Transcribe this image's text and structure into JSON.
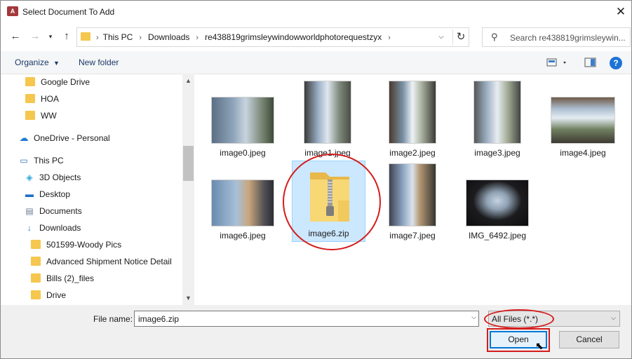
{
  "window": {
    "title": "Select Document To Add",
    "app_icon_text": "A"
  },
  "nav": {
    "breadcrumbs": [
      "This PC",
      "Downloads",
      "re438819grimsleywindowworldphotorequestzyx"
    ],
    "search_placeholder": "Search re438819grimsleywin..."
  },
  "toolbar": {
    "organize_label": "Organize",
    "new_folder_label": "New folder"
  },
  "sidebar": {
    "items": [
      {
        "label": "Google Drive",
        "icon": "folder-icon"
      },
      {
        "label": "HOA",
        "icon": "folder-icon"
      },
      {
        "label": "WW",
        "icon": "folder-icon"
      },
      {
        "label": "OneDrive - Personal",
        "icon": "cloud-icon"
      },
      {
        "label": "This PC",
        "icon": "computer-icon"
      },
      {
        "label": "3D Objects",
        "icon": "cube-icon"
      },
      {
        "label": "Desktop",
        "icon": "desktop-icon"
      },
      {
        "label": "Documents",
        "icon": "document-icon"
      },
      {
        "label": "Downloads",
        "icon": "download-icon"
      },
      {
        "label": "501599-Woody Pics",
        "icon": "folder-icon"
      },
      {
        "label": "Advanced Shipment Notice Detail",
        "icon": "folder-icon"
      },
      {
        "label": "Bills (2)_files",
        "icon": "folder-icon"
      },
      {
        "label": "Drive",
        "icon": "folder-icon"
      }
    ]
  },
  "files": [
    {
      "name": "image0.jpeg",
      "type": "photo"
    },
    {
      "name": "image1.jpeg",
      "type": "photo"
    },
    {
      "name": "image2.jpeg",
      "type": "photo"
    },
    {
      "name": "image3.jpeg",
      "type": "photo"
    },
    {
      "name": "image4.jpeg",
      "type": "photo"
    },
    {
      "name": "image6.jpeg",
      "type": "photo"
    },
    {
      "name": "image6.zip",
      "type": "zip",
      "selected": true
    },
    {
      "name": "image7.jpeg",
      "type": "photo"
    },
    {
      "name": "IMG_6492.jpeg",
      "type": "photo"
    }
  ],
  "bottom": {
    "file_name_label": "File name:",
    "file_name_value": "image6.zip",
    "file_type_filter": "All Files (*.*)",
    "open_label": "Open",
    "cancel_label": "Cancel"
  },
  "colors": {
    "accent": "#0078d7",
    "annotation_red": "#d41c1c",
    "selection": "#cce8ff"
  }
}
